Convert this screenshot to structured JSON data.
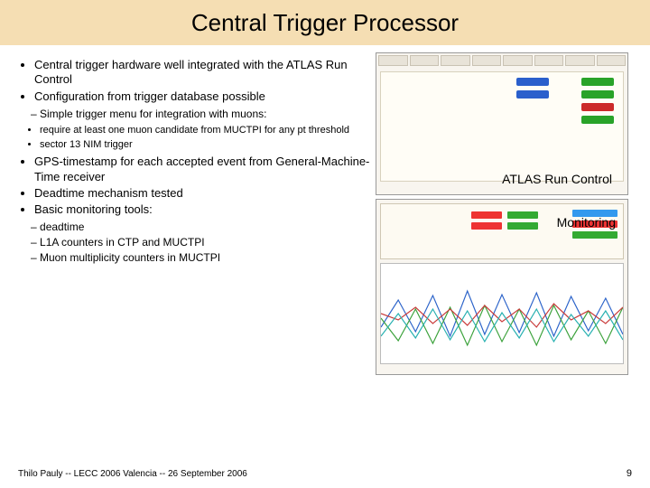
{
  "title": "Central Trigger Processor",
  "bullets": {
    "b1": "Central trigger hardware well integrated with the ATLAS Run Control",
    "b2": "Configuration from trigger database possible",
    "b2a": "Simple trigger menu for integration with muons:",
    "b2a1": "require at least one muon candidate from MUCTPI for any pt threshold",
    "b2a2": "sector 13 NIM trigger",
    "b3": "GPS-timestamp for each accepted event from General-Machine-Time receiver",
    "b4": "Deadtime mechanism tested",
    "b5": "Basic monitoring tools:",
    "b5a": "deadtime",
    "b5b": "L1A counters in CTP and MUCTPI",
    "b5c": "Muon multiplicity counters in MUCTPI"
  },
  "labels": {
    "run_control": "ATLAS Run Control",
    "monitoring": "Monitoring"
  },
  "footer": "Thilo Pauly -- LECC 2006 Valencia -- 26 September 2006",
  "page": "9"
}
